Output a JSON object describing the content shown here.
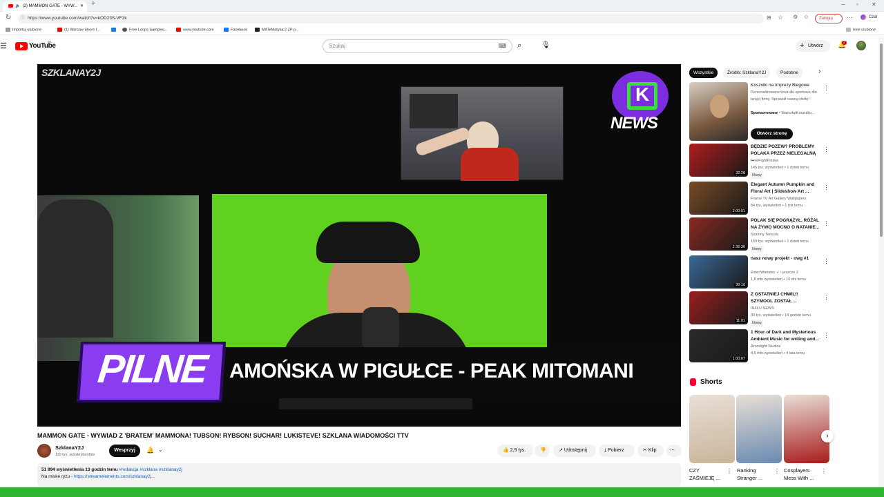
{
  "browser": {
    "tab_title": "(2) MAMMON GATE - WYW...",
    "url": "https://www.youtube.com/watch?v=kOD23S-VF3k",
    "login_label": "Zaloguj",
    "chat_label": "Czat",
    "bookmarks": [
      "Importuj ulubione",
      "(1) Warsaw Shore I...",
      "Free Loops Samples...",
      "www.youtube.com",
      "Facebook",
      "MATeMatyka 2 ZP p..."
    ],
    "other_favorites": "Inne ulubione"
  },
  "youtube": {
    "logo_text": "YouTube",
    "logo_region": "PL",
    "search_placeholder": "Szukaj",
    "create_label": "Utwórz",
    "notif_count": "2"
  },
  "video": {
    "overlay_brand": "SZKLANAY2J",
    "news_badge": "NEWS",
    "pilne_text": "PILNE",
    "ticker_text": "AMOŃSKA W PIGUŁCE - PEAK MITOMANI",
    "title": "MAMMON GATE - WYWIAD Z 'BRATEM' MAMMONA! TUBSON! RYBSON! SUCHAR! LUKISTEVE! SZKLANA WIADOMOŚCI TTV"
  },
  "channel": {
    "name": "SzklanaY2J",
    "subs": "119 tys. subskrybentów",
    "support_label": "Wesprzyj"
  },
  "actions": {
    "likes": "2,9 tys.",
    "share": "Udostępnij",
    "download": "Pobierz",
    "clip": "Klip"
  },
  "description": {
    "stats": "51 994 wyświetlenia  13 godzin temu",
    "tags": "#redakcja #szklana #szklanay2j",
    "line2": "Na miske ryżu - ",
    "link": "https://streamelements.com/szklanay2j..."
  },
  "filters": [
    "Wszystkie",
    "Źródło: SzklanaY2J",
    "Podobne"
  ],
  "ad": {
    "title": "Koszulki na Imprezy Biegowe",
    "desc": "Personalizowane koszulki sportowe dla twojej firmy. Sprawdź naszą ofertę!",
    "sponsored": "Sponsorowane",
    "advertiser": "WarsztatKoszulko...",
    "cta": "Otwórz stronę"
  },
  "related": [
    {
      "title": "BĘDZIE POZEW? PROBLEMY POLAKA PRZEZ NIELEGALNĄ ...",
      "channel": "FreeFightPolska",
      "meta": "145 tys. wyświetleń • 1 dzień temu",
      "badge": "Nowy",
      "duration": "32:28",
      "color": "#b01c1c"
    },
    {
      "title": "Elegant Autumn Pumpkin and Floral Art | Slideshow Art ...",
      "channel": "Frame TV Art Gallery Wallpapers",
      "meta": "84 tys. wyświetleń • 1 rok temu",
      "badge": "",
      "duration": "2:00:01",
      "color": "#7a4a24"
    },
    {
      "title": "POLAK SIĘ POGRĄŻYŁ, RÓŻAL NA ŻYWO MOCNO O NATANIE...",
      "channel": "Szalony Tancula",
      "meta": "159 tys. wyświetleń • 1 dzień temu",
      "badge": "Nowy",
      "duration": "2:32:30",
      "color": "#8a2a22"
    },
    {
      "title": "nasz nowy projekt - owg #1",
      "channel": "PatecWariatec ✓ i jeszcze 2",
      "meta": "1,8 mln wyświetleń • 10 dni temu",
      "badge": "",
      "duration": "36:10",
      "color": "#3a6a9a"
    },
    {
      "title": "Z OSTATNIEJ CHWILI! SZYMOOL ZOSTAŁ ...",
      "channel": "INFLU NEWS",
      "meta": "30 tys. wyświetleń • 14 godzin temu",
      "badge": "Nowy",
      "duration": "11:01",
      "color": "#9a1e1e"
    },
    {
      "title": "1 Hour of Dark and Mysterious Ambient Music for writing and...",
      "channel": "Arondight Studios",
      "meta": "4,6 mln wyświetleń • 4 lata temu",
      "badge": "",
      "duration": "1:00:07",
      "color": "#2a2a2a"
    }
  ],
  "shorts": {
    "heading": "Shorts",
    "items": [
      {
        "title": "CZY ZAŚMIEJĘ ...",
        "color": "#c9b59a"
      },
      {
        "title": "Ranking Stranger ...",
        "color": "#6a8ab0"
      },
      {
        "title": "Cosplayers Mess With ...",
        "color": "#a81c1c"
      }
    ]
  },
  "colors": {
    "youtube_red": "#ff0000",
    "greenscreen": "#5fd11e",
    "purple": "#8a3cf0",
    "bottom_bar": "#2fb52f"
  }
}
